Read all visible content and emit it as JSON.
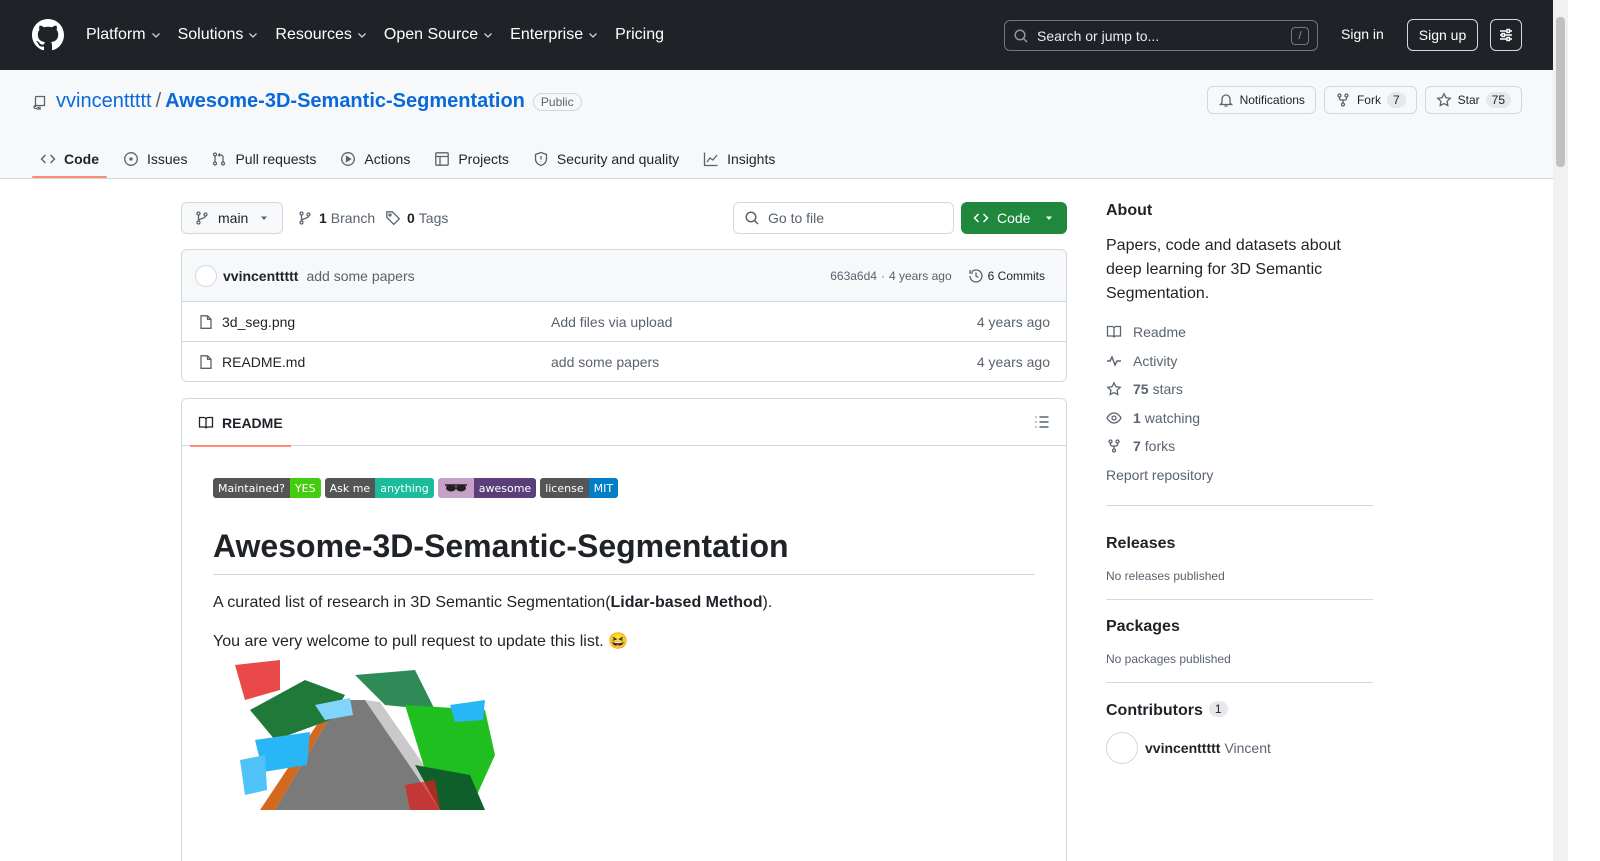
{
  "topbar": {
    "nav": [
      "Platform",
      "Solutions",
      "Resources",
      "Open Source",
      "Enterprise"
    ],
    "pricing": "Pricing",
    "search_placeholder": "Search or jump to...",
    "search_key": "/",
    "signin": "Sign in",
    "signup": "Sign up"
  },
  "repo": {
    "owner": "vvincenttttt",
    "separator": "/",
    "name": "Awesome-3D-Semantic-Segmentation",
    "visibility": "Public",
    "notifications": "Notifications",
    "fork_label": "Fork",
    "fork_count": "7",
    "star_label": "Star",
    "star_count": "75"
  },
  "tabs": [
    "Code",
    "Issues",
    "Pull requests",
    "Actions",
    "Projects",
    "Security and quality",
    "Insights"
  ],
  "toolbar": {
    "branch": "main",
    "branch_count": "1",
    "branch_label": "Branch",
    "tag_count": "0",
    "tag_label": "Tags",
    "goto_placeholder": "Go to file",
    "code_label": "Code"
  },
  "commit": {
    "author": "vvincenttttt",
    "message": "add some papers",
    "hash": "663a6d4",
    "sep": "·",
    "time": "4 years ago",
    "count_label": "6 Commits"
  },
  "files": [
    {
      "name": "3d_seg.png",
      "message": "Add files via upload",
      "date": "4 years ago"
    },
    {
      "name": "README.md",
      "message": "add some papers",
      "date": "4 years ago"
    }
  ],
  "readme": {
    "tab": "README",
    "badges": [
      {
        "left": "Maintained?",
        "right": "YES",
        "lc": "#555555",
        "rc": "#4c1"
      },
      {
        "left": "Ask me",
        "right": "anything",
        "lc": "#555555",
        "rc": "#1abc9c"
      },
      {
        "left": "",
        "right": "awesome",
        "lc": "#c7a0c8",
        "rc": "#5b3f7a"
      },
      {
        "left": "license",
        "right": "MIT",
        "lc": "#555555",
        "rc": "#007ec6"
      }
    ],
    "title": "Awesome-3D-Semantic-Segmentation",
    "intro_prefix": "A curated list of research in 3D Semantic Segmentation(",
    "intro_bold": "Lidar-based Method",
    "intro_suffix": ").",
    "welcome": "You are very welcome to pull request to update this list. 😆"
  },
  "sidebar": {
    "about_title": "About",
    "description": "Papers, code and datasets about deep learning for 3D Semantic Segmentation.",
    "readme": "Readme",
    "activity": "Activity",
    "stars_count": "75",
    "stars_label": "stars",
    "watching_count": "1",
    "watching_label": "watching",
    "forks_count": "7",
    "forks_label": "forks",
    "report": "Report repository",
    "releases_title": "Releases",
    "releases_text": "No releases published",
    "packages_title": "Packages",
    "packages_text": "No packages published",
    "contributors_title": "Contributors",
    "contributors_count": "1",
    "contributor_login": "vvincenttttt",
    "contributor_name": "Vincent"
  },
  "colors": {
    "header_bg": "#1f2328",
    "link": "#0969da",
    "primary_button": "#1f883d",
    "tab_underline": "#fd8c73"
  }
}
